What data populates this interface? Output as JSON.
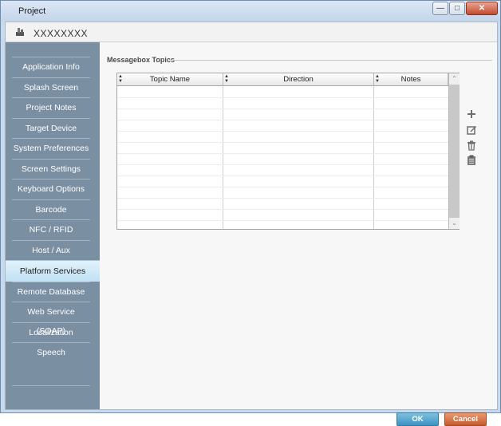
{
  "window": {
    "title": "Project"
  },
  "header": {
    "project_name": "XXXXXXXX",
    "icon": "project-icon"
  },
  "sidebar": {
    "items": [
      {
        "label": "Application Info"
      },
      {
        "label": "Splash Screen"
      },
      {
        "label": "Project Notes"
      },
      {
        "label": "Target Device"
      },
      {
        "label": "System Preferences"
      },
      {
        "label": "Screen Settings"
      },
      {
        "label": "Keyboard Options"
      },
      {
        "label": "Barcode"
      },
      {
        "label": "NFC / RFID"
      },
      {
        "label": "Host / Aux"
      },
      {
        "label": "Platform Services",
        "active": true
      },
      {
        "label": "Remote Database"
      },
      {
        "label": "Web Service (SOAP)"
      },
      {
        "label": "Localization"
      },
      {
        "label": "Speech"
      }
    ]
  },
  "main": {
    "group_title": "Messagebox Topics",
    "grid": {
      "columns": [
        "Topic Name",
        "Direction",
        "Notes"
      ],
      "rows": []
    },
    "tools": [
      "add-icon",
      "edit-icon",
      "delete-icon",
      "paste-icon"
    ]
  },
  "footer": {
    "ok_label": "OK",
    "cancel_label": "Cancel"
  },
  "colors": {
    "sidebar": "#7b8fa2",
    "active_item": "#bfe1f3",
    "ok": "#3d93c2",
    "cancel": "#c55a2a"
  }
}
